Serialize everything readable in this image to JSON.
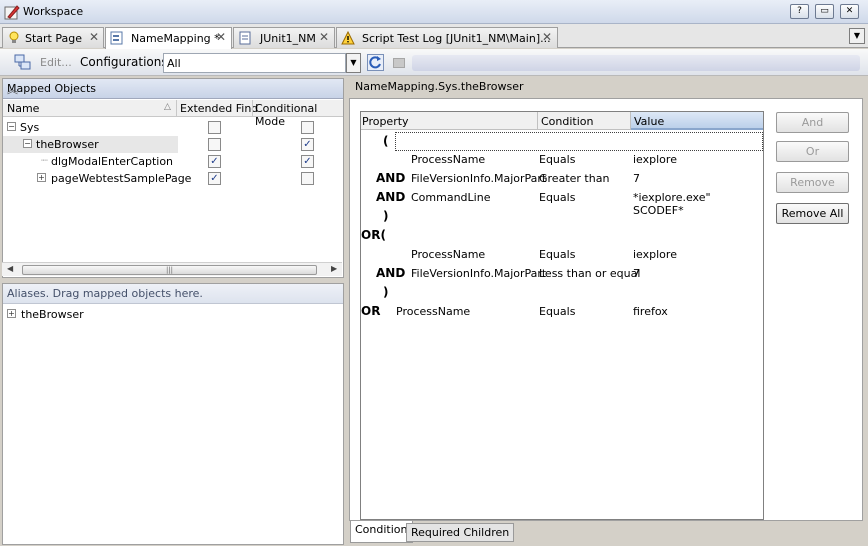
{
  "window": {
    "title": "Workspace",
    "buttons": [
      "?",
      "▭",
      "✕"
    ]
  },
  "tabs": [
    {
      "label": "Start Page",
      "icon": "lightbulb-icon",
      "active": false
    },
    {
      "label": "NameMapping *",
      "icon": "namemapping-icon",
      "active": true
    },
    {
      "label": "JUnit1_NM",
      "icon": "document-icon",
      "active": false
    },
    {
      "label": "Script Test Log [JUnit1_NM\\Main]...",
      "icon": "warning-log-icon",
      "active": false
    }
  ],
  "toolbar": {
    "edit_label": "Edit...",
    "configurations_label": "Configurations",
    "filter_value": "All"
  },
  "mapped_objects": {
    "title": "Mapped Objects",
    "columns": [
      "Name",
      "Extended Find",
      "Conditional Mode"
    ],
    "rows": [
      {
        "name": "Sys",
        "level": 0,
        "expander": "⊟",
        "extended_find": false,
        "conditional_mode": false
      },
      {
        "name": "theBrowser",
        "level": 1,
        "expander": "⊟",
        "extended_find": false,
        "conditional_mode": true
      },
      {
        "name": "dlgModalEnterCaption",
        "level": 2,
        "expander": "",
        "extended_find": true,
        "conditional_mode": true
      },
      {
        "name": "pageWebtestSamplePage",
        "level": 2,
        "expander": "⊞",
        "extended_find": true,
        "conditional_mode": false
      }
    ]
  },
  "aliases": {
    "title": "Aliases. Drag mapped objects here.",
    "items": [
      "theBrowser"
    ]
  },
  "object_path": "NameMapping.Sys.theBrowser",
  "condition_table": {
    "columns": [
      "Property",
      "Condition",
      "Value"
    ],
    "rows": [
      {
        "op": "(",
        "property": "",
        "condition": "",
        "value": ""
      },
      {
        "op": "",
        "property": "ProcessName",
        "condition": "Equals",
        "value": "iexplore"
      },
      {
        "op": "AND",
        "property": "FileVersionInfo.MajorPart",
        "condition": "Greater than",
        "value": "7"
      },
      {
        "op": "AND",
        "property": "CommandLine",
        "condition": "Equals",
        "value": "*iexplore.exe\" SCODEF*"
      },
      {
        "op": ")",
        "property": "",
        "condition": "",
        "value": ""
      },
      {
        "op": "OR(",
        "property": "",
        "condition": "",
        "value": ""
      },
      {
        "op": "",
        "property": "ProcessName",
        "condition": "Equals",
        "value": "iexplore"
      },
      {
        "op": "AND",
        "property": "FileVersionInfo.MajorPart",
        "condition": "Less than or equal",
        "value": "7"
      },
      {
        "op": ")",
        "property": "",
        "condition": "",
        "value": ""
      },
      {
        "op": "OR",
        "property": "ProcessName",
        "condition": "Equals",
        "value": "firefox"
      }
    ]
  },
  "side_buttons": [
    {
      "label": "And",
      "enabled": false
    },
    {
      "label": "Or",
      "enabled": false
    },
    {
      "label": "Remove",
      "enabled": false
    },
    {
      "label": "Remove All",
      "enabled": true
    }
  ],
  "bottom_tabs": [
    {
      "label": "Condition",
      "active": true
    },
    {
      "label": "Required Children",
      "active": false
    }
  ]
}
